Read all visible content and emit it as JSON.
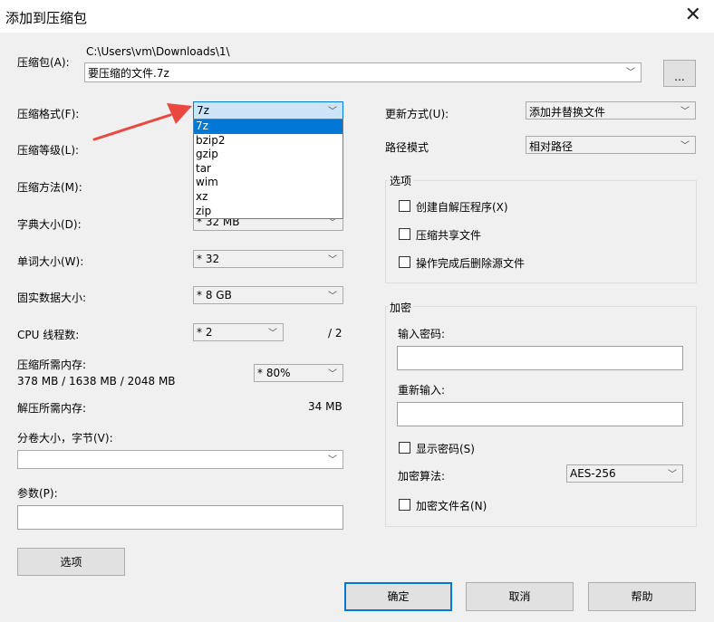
{
  "window": {
    "title": "添加到压缩包",
    "close": "✕"
  },
  "archive": {
    "label": "压缩包(A):",
    "path": "C:\\Users\\vm\\Downloads\\1\\",
    "filename": "要压缩的文件.7z",
    "browse_label": "..."
  },
  "left": {
    "format_label": "压缩格式(F):",
    "format_value": "7z",
    "format_options": [
      "7z",
      "bzip2",
      "gzip",
      "tar",
      "wim",
      "xz",
      "zip"
    ],
    "level_label": "压缩等级(L):",
    "method_label": "压缩方法(M):",
    "dict_label": "字典大小(D):",
    "dict_value": "* 32 MB",
    "word_label": "单词大小(W):",
    "word_value": "* 32",
    "solid_label": "固实数据大小:",
    "solid_value": "* 8 GB",
    "threads_label": "CPU 线程数:",
    "threads_value": "* 2",
    "threads_total": "/ 2",
    "mem_compress_label": "压缩所需内存:",
    "mem_compress_value": "378 MB / 1638 MB / 2048 MB",
    "mem_percent": "* 80%",
    "mem_decompress_label": "解压所需内存:",
    "mem_decompress_value": "34 MB",
    "split_label": "分卷大小，字节(V):",
    "split_value": "",
    "params_label": "参数(P):",
    "params_value": "",
    "options_button": "选项"
  },
  "right": {
    "update_label": "更新方式(U):",
    "update_value": "添加并替换文件",
    "path_mode_label": "路径模式",
    "path_mode_value": "相对路径",
    "options_group": "选项",
    "opt_sfx": "创建自解压程序(X)",
    "opt_shared": "压缩共享文件",
    "opt_delete": "操作完成后删除源文件",
    "encrypt_group": "加密",
    "password_label": "输入密码:",
    "reenter_label": "重新输入:",
    "show_password": "显示密码(S)",
    "enc_method_label": "加密算法:",
    "enc_method_value": "AES-256",
    "encrypt_names": "加密文件名(N)"
  },
  "buttons": {
    "ok": "确定",
    "cancel": "取消",
    "help": "帮助"
  },
  "colors": {
    "arrow": "#e8483f",
    "selection": "#0078d7"
  }
}
